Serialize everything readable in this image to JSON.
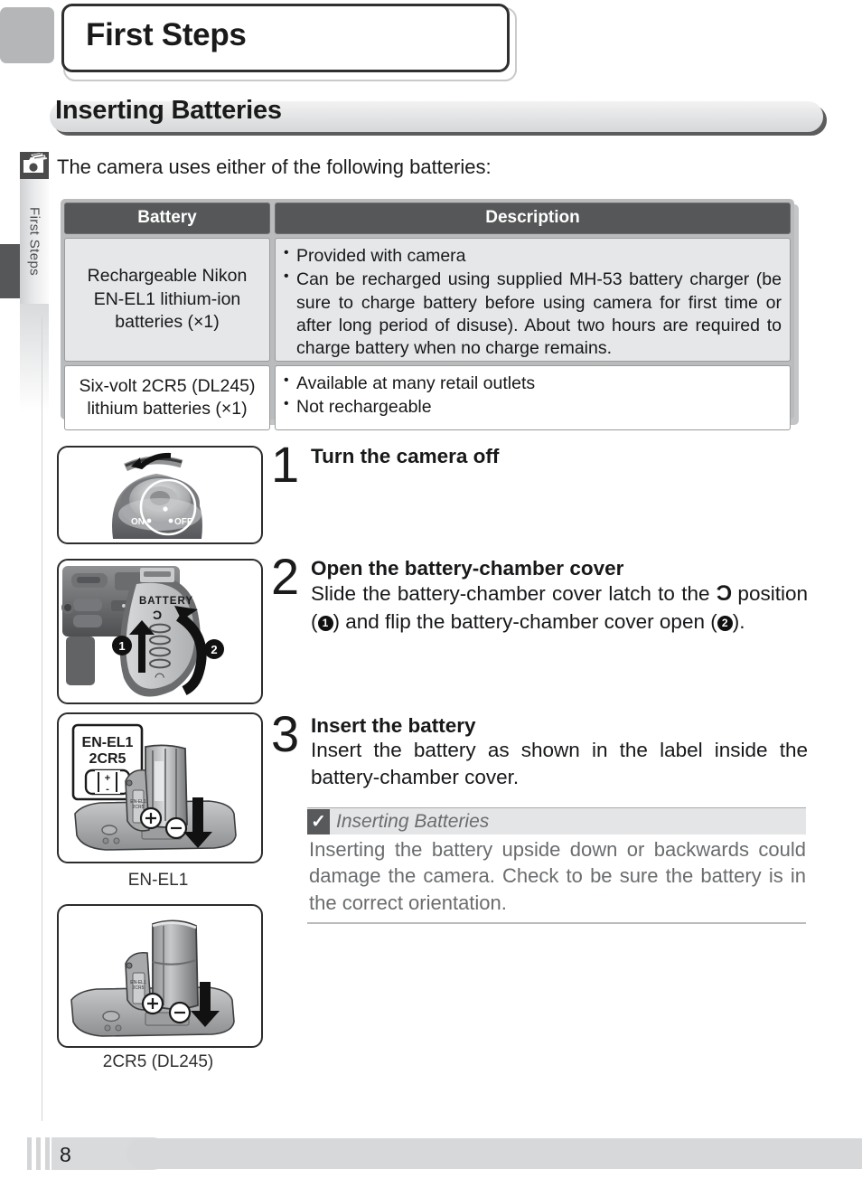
{
  "chapter": {
    "title": "First Steps"
  },
  "section": {
    "title": "Inserting Batteries"
  },
  "sidebar": {
    "label": "First Steps",
    "icon": "camera-hand-icon"
  },
  "intro": {
    "text": "The camera uses either of the following batteries:"
  },
  "table": {
    "headers": {
      "battery": "Battery",
      "description": "Description"
    },
    "rows": [
      {
        "name": "Rechargeable Nikon EN-EL1 lithium-ion batteries (×1)",
        "bullets": [
          "Provided with camera",
          "Can be recharged using supplied MH-53 battery charger (be sure to charge battery before using camera for first time or after long period of disuse).  About two hours are required to charge battery when no charge remains."
        ]
      },
      {
        "name": "Six-volt 2CR5 (DL245) lithium batteries (×1)",
        "bullets": [
          "Available at many retail outlets",
          "Not rechargeable"
        ]
      }
    ]
  },
  "steps": [
    {
      "number": "1",
      "heading": "Turn the camera off",
      "text": ""
    },
    {
      "number": "2",
      "heading": "Open the battery-chamber cover",
      "text_part1": "Slide the battery-chamber cover latch to the ",
      "latch_symbol": "Ɔ",
      "text_part2": " position (",
      "marker1": "1",
      "text_part3": ") and flip the battery-chamber cover open (",
      "marker2": "2",
      "text_part4": ")."
    },
    {
      "number": "3",
      "heading": "Insert the battery",
      "text": "Insert the battery as shown in the label inside the battery-chamber cover."
    }
  ],
  "caution": {
    "icon": "checkmark-icon",
    "title": "Inserting Batteries",
    "body": "Inserting the battery upside down or backwards could damage the camera.  Check to be sure the battery is in the correct orientation."
  },
  "figures": {
    "fig1": {
      "name": "power-switch-illustration",
      "labels": {
        "on": "ON",
        "off": "OFF"
      }
    },
    "fig2": {
      "name": "battery-chamber-cover-illustration",
      "labels": {
        "battery": "BATTERY",
        "marker1": "1",
        "marker2": "2"
      }
    },
    "fig3": {
      "name": "en-el1-insertion-illustration",
      "labels": {
        "line1": "EN-EL1",
        "line2": "2CR5",
        "plus": "+",
        "minus": "–"
      }
    },
    "fig4": {
      "name": "2cr5-insertion-illustration",
      "labels": {
        "plus": "+",
        "minus": "–"
      }
    },
    "caption1": "EN-EL1",
    "caption2": "2CR5 (DL245)"
  },
  "footer": {
    "page_number": "8"
  },
  "colors": {
    "header_dark": "#565758",
    "cell_gray": "#e5e7e9",
    "frame_gray": "#b9bbbd",
    "caution_gray": "#6a6c6e",
    "footer_gray": "#d7d8da"
  }
}
